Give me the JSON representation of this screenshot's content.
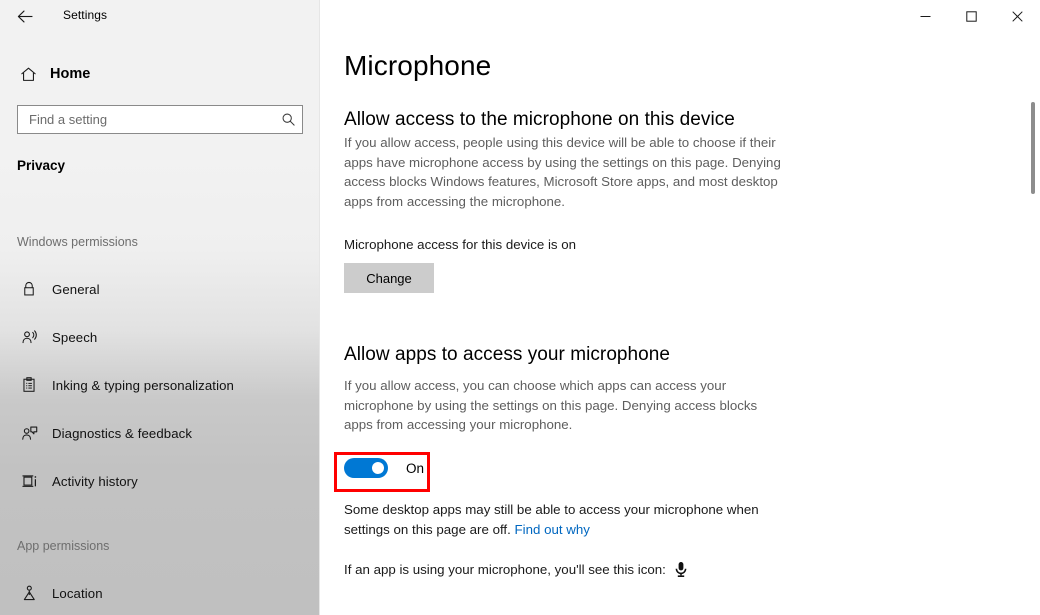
{
  "titlebar": {
    "app_title": "Settings",
    "back_icon": "back-arrow-icon",
    "minimize_label": "Minimize",
    "maximize_label": "Maximize",
    "close_label": "Close"
  },
  "sidebar": {
    "home_label": "Home",
    "home_icon": "home-icon",
    "search": {
      "placeholder": "Find a setting",
      "value": "",
      "icon": "search-icon"
    },
    "category_title": "Privacy",
    "groups": [
      {
        "label": "Windows permissions",
        "items": [
          {
            "label": "General",
            "icon": "lock-icon"
          },
          {
            "label": "Speech",
            "icon": "person-speech-icon"
          },
          {
            "label": "Inking & typing personalization",
            "icon": "clipboard-icon"
          },
          {
            "label": "Diagnostics & feedback",
            "icon": "person-feedback-icon"
          },
          {
            "label": "Activity history",
            "icon": "activity-history-icon"
          }
        ]
      },
      {
        "label": "App permissions",
        "items": [
          {
            "label": "Location",
            "icon": "location-person-icon"
          }
        ]
      }
    ]
  },
  "main": {
    "page_title": "Microphone",
    "section_device": {
      "heading": "Allow access to the microphone on this device",
      "body": "If you allow access, people using this device will be able to choose if their apps have microphone access by using the settings on this page. Denying access blocks Windows features, Microsoft Store apps, and most desktop apps from accessing the microphone.",
      "status": "Microphone access for this device is on",
      "change_button": "Change"
    },
    "section_apps": {
      "heading": "Allow apps to access your microphone",
      "body": "If you allow access, you can choose which apps can access your microphone by using the settings on this page. Denying access blocks apps from accessing your microphone.",
      "toggle_state": "On",
      "note_text": "Some desktop apps may still be able to access your microphone when settings on this page are off. ",
      "note_link": "Find out why",
      "icon_note": "If an app is using your microphone, you'll see this icon:",
      "icon_name": "microphone-icon"
    }
  },
  "colors": {
    "accent": "#0078d4",
    "link": "#0067c0",
    "highlight": "#ff0000",
    "button_bg": "#cccccc"
  },
  "scrollbar": {
    "thumb_top_pct": 12,
    "thumb_height_pct": 16
  }
}
